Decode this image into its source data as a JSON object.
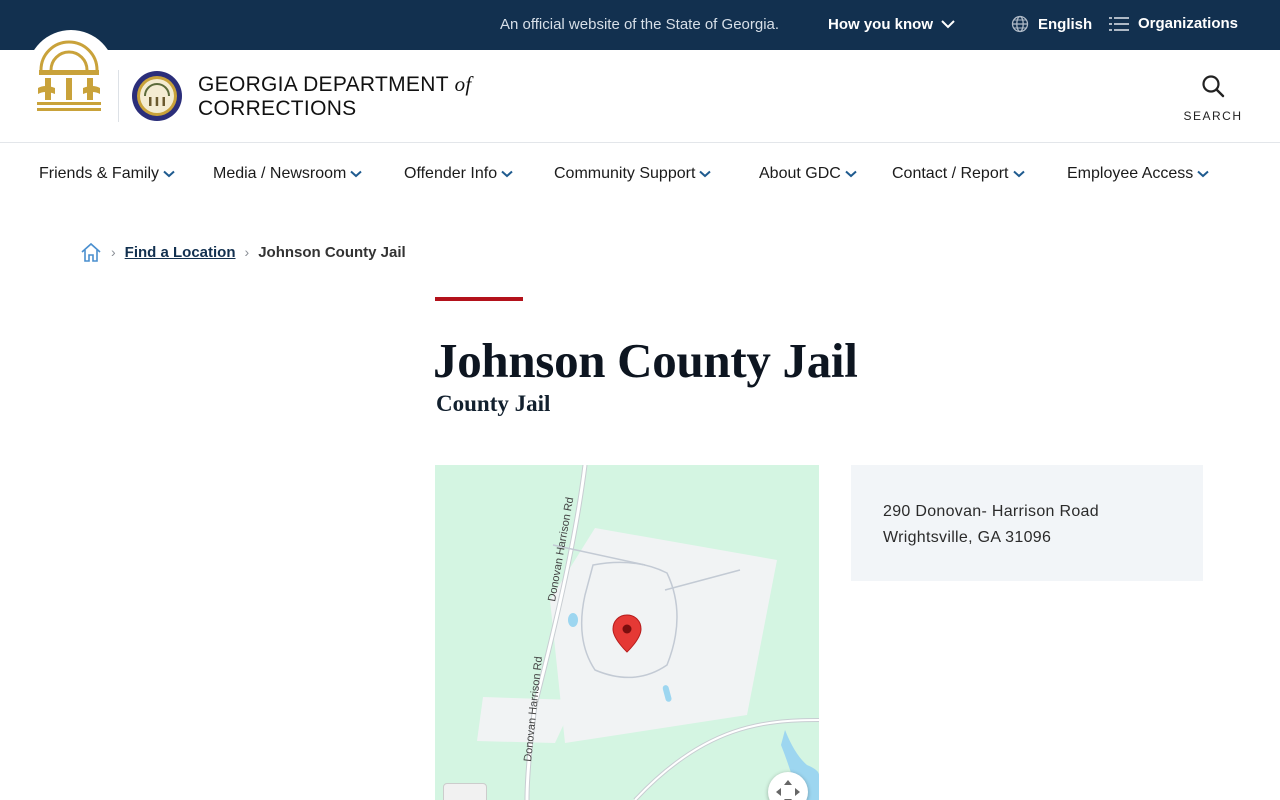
{
  "topbar": {
    "official_text": "An official website of the State of Georgia.",
    "how_you_know": "How you know",
    "language": "English",
    "organizations": "Organizations"
  },
  "header": {
    "brand_line1": "GEORGIA DEPARTMENT",
    "brand_of": "of",
    "brand_line2": "CORRECTIONS",
    "search_label": "SEARCH"
  },
  "nav": {
    "items": [
      {
        "label": "Friends & Family"
      },
      {
        "label": "Media / Newsroom"
      },
      {
        "label": "Offender Info"
      },
      {
        "label": "Community Support"
      },
      {
        "label": "About GDC"
      },
      {
        "label": "Contact / Report"
      },
      {
        "label": "Employee Access"
      }
    ]
  },
  "breadcrumb": {
    "link": "Find a Location",
    "current": "Johnson County Jail"
  },
  "page": {
    "title": "Johnson County Jail",
    "subtitle": "County Jail"
  },
  "map": {
    "road_label_top": "Donovan Harrison Rd",
    "road_label_bottom": "Donovan Harrison Rd"
  },
  "address": {
    "line1": "290 Donovan- Harrison Road",
    "line2": "Wrightsville, GA 31096"
  },
  "colors": {
    "topbar_bg": "#12304f",
    "accent_red": "#b3121b",
    "map_green": "#d4f5e2",
    "pin_red": "#e53935"
  }
}
